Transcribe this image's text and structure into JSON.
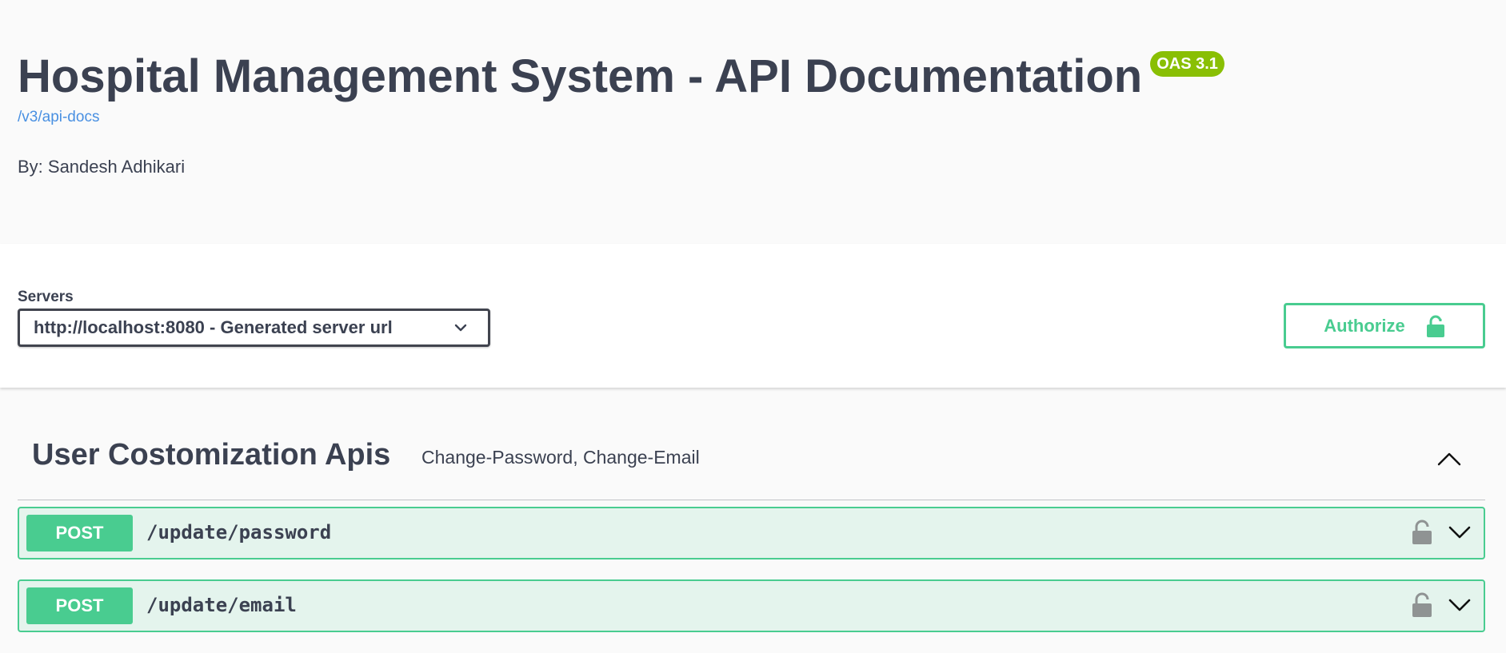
{
  "info": {
    "title": "Hospital Management System - API Documentation",
    "version_badge": "OAS 3.1",
    "docs_link": "/v3/api-docs",
    "byline": "By: Sandesh Adhikari"
  },
  "servers": {
    "label": "Servers",
    "selected": "http://localhost:8080 - Generated server url"
  },
  "authorize": {
    "label": "Authorize"
  },
  "tag": {
    "name": "User Costomization Apis",
    "description": "Change-Password, Change-Email",
    "expanded": true
  },
  "operations": [
    {
      "method": "POST",
      "path": "/update/password"
    },
    {
      "method": "POST",
      "path": "/update/email"
    }
  ],
  "colors": {
    "post_accent": "#49cc90",
    "badge": "#89bf04",
    "link": "#4990e2",
    "text": "#3b4151"
  },
  "icons": {
    "server_dropdown": "chevron-down-icon",
    "authorize": "lock-icon",
    "tag_toggle": "chevron-up-icon",
    "operation_lock": "unlocked-icon",
    "operation_toggle": "chevron-down-icon"
  }
}
